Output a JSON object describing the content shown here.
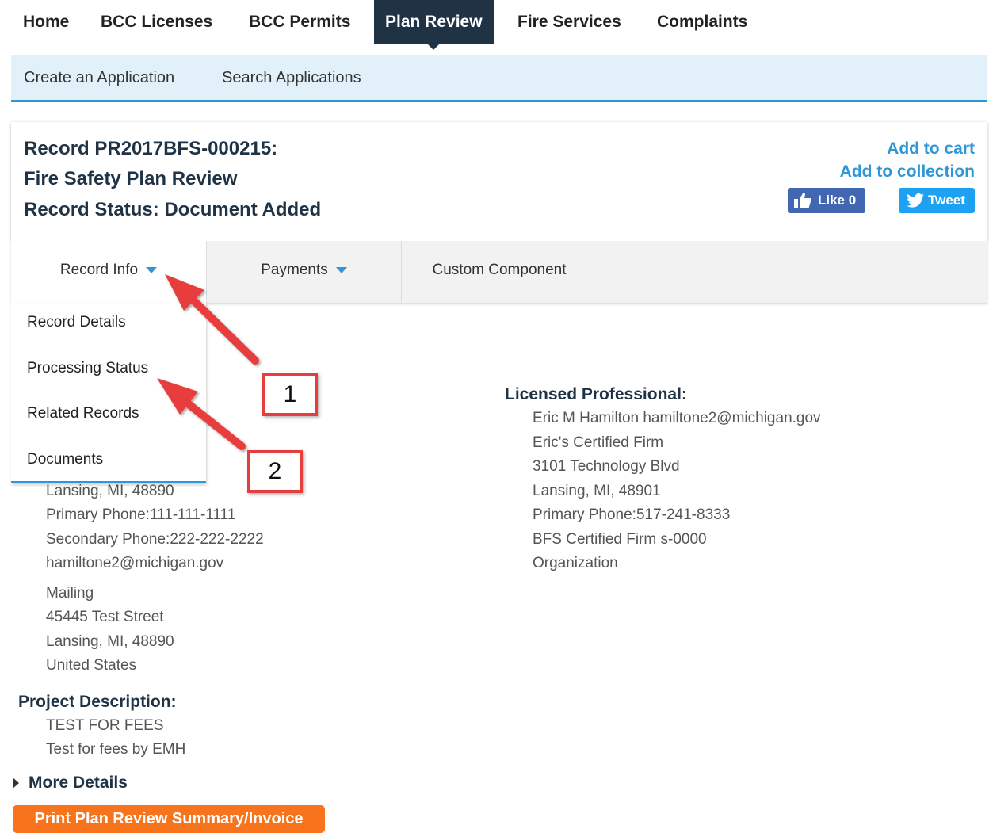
{
  "topnav": {
    "items": [
      "Home",
      "BCC Licenses",
      "BCC Permits",
      "Plan Review",
      "Fire Services",
      "Complaints"
    ],
    "active": "Plan Review"
  },
  "subnav": {
    "create": "Create an Application",
    "search": "Search Applications"
  },
  "record": {
    "line1": "Record PR2017BFS-000215:",
    "line2": "Fire Safety Plan Review",
    "line3": "Record Status: Document Added"
  },
  "actions": {
    "add_cart": "Add to cart",
    "add_collection": "Add to collection",
    "like": "Like 0",
    "tweet": "Tweet"
  },
  "tabs": {
    "record_info": "Record Info",
    "payments": "Payments",
    "custom": "Custom Component"
  },
  "dropdown": [
    "Record Details",
    "Processing Status",
    "Related Records",
    "Documents"
  ],
  "applicant": {
    "city": "Lansing, MI, 48890",
    "primary": "Primary Phone:111-111-1111",
    "secondary": "Secondary Phone:222-222-2222",
    "email": "hamiltone2@michigan.gov",
    "mailing_label": "Mailing",
    "mailing_street": "45445 Test Street",
    "mailing_city": "Lansing, MI, 48890",
    "mailing_country": "United States"
  },
  "licensed": {
    "heading": "Licensed Professional:",
    "lines": [
      "Eric M Hamilton hamiltone2@michigan.gov",
      "Eric's Certified Firm",
      "3101 Technology Blvd",
      "Lansing, MI, 48901",
      "Primary Phone:517-241-8333",
      "BFS Certified Firm s-0000",
      "Organization"
    ]
  },
  "project": {
    "heading": "Project Description:",
    "line1": "TEST FOR FEES",
    "line2": "Test for fees by EMH"
  },
  "more_details": "More Details",
  "print_button": "Print Plan Review Summary/Invoice",
  "annotations": [
    "1",
    "2"
  ],
  "colors": {
    "nav_dark": "#1f3345",
    "accent_blue": "#2e97d8",
    "subnav_bg": "#e1f0f9",
    "print_orange": "#f7741c",
    "annotation_red": "#e83d3d"
  }
}
